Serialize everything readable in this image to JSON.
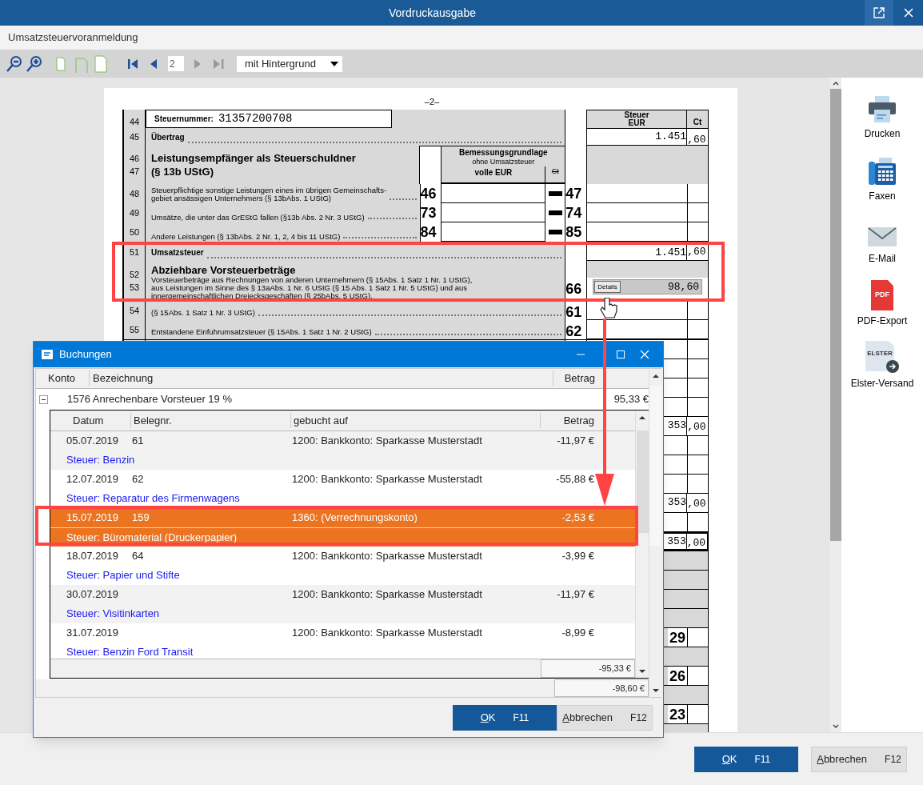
{
  "window": {
    "title": "Vordruckausgabe"
  },
  "header": {
    "title": "Umsatzsteuervoranmeldung"
  },
  "toolbar": {
    "page": "2",
    "background_mode": "mit Hintergrund",
    "nav": [
      {
        "kind": "first",
        "disabled": false
      },
      {
        "kind": "prev",
        "disabled": false
      },
      {
        "kind": "next",
        "disabled": true
      },
      {
        "kind": "last",
        "disabled": true
      }
    ]
  },
  "form": {
    "page_label": "–2–",
    "tax_id_line": "44",
    "tax_id_label": "Steuernummer:",
    "tax_id": "31357200708",
    "tax_header": {
      "line1": "Steuer",
      "line2": "EUR",
      "ct": "Ct"
    },
    "carry": {
      "line": "45",
      "label": "Übertrag",
      "eur": "1.451",
      "ct": ",60"
    },
    "section_13b": {
      "lines": [
        "46",
        "47"
      ],
      "heading": "Leistungsempfänger als Steuerschuldner",
      "subheading": "(§ 13b UStG)"
    },
    "base_header": {
      "line1": "Bemessungsgrundlage",
      "line2": "ohne Umsatzsteuer",
      "line3": "volle EUR",
      "ct": "Ct"
    },
    "rows_13b": [
      {
        "line": "48",
        "text": [
          "Steuerpflichtige sonstige Leistungen eines im übrigen Gemeinschafts-",
          "gebiet ansässigen Unternehmers (§ 13bAbs. 1 UStG)"
        ],
        "code_base": "46",
        "code_tax": "47"
      },
      {
        "line": "49",
        "text": [
          "Umsätze, die unter das GrEStG fallen (§13b Abs. 2 Nr. 3 UStG)"
        ],
        "code_base": "73",
        "code_tax": "74"
      },
      {
        "line": "50",
        "text": [
          "Andere Leistungen (§ 13bAbs. 2 Nr. 1, 2, 4 bis 11 UStG)"
        ],
        "code_base": "84",
        "code_tax": "85"
      }
    ],
    "vat": {
      "line": "51",
      "label": "Umsatzsteuer",
      "eur": "1.451",
      "ct": ",60"
    },
    "input_tax": {
      "lines": [
        "52",
        "53"
      ],
      "heading": "Abziehbare Vorsteuerbeträge",
      "text": [
        "Vorsteuerbeträge aus Rechnungen von anderen Unternehmern (§ 15Abs. 1 Satz 1 Nr. 1 UStG),",
        "aus Leistungen im Sinne des § 13aAbs. 1 Nr. 6 UStG (§ 15 Abs. 1 Satz 1 Nr. 5 UStG) und aus",
        "innergemeinschaftlichen Dreiecksgeschäften (§ 25bAbs. 5 UStG)."
      ],
      "code": "66",
      "details_button": "Details",
      "value": "98,60"
    },
    "rows_after": [
      {
        "line": "54",
        "text": "(§ 15Abs. 1 Satz 1  Nr. 3 UStG)",
        "code": "61"
      },
      {
        "line": "55",
        "text": "Entstandene Einfuhrumsatzsteuer (§ 15Abs. 1 Satz 1 Nr. 2 UStG)",
        "code": "62"
      }
    ],
    "lower_rows": [
      {
        "kind": "blank"
      },
      {
        "kind": "blank"
      },
      {
        "kind": "blank"
      },
      {
        "kind": "blank"
      },
      {
        "kind": "amount",
        "eur": "353",
        "ct": ",00"
      },
      {
        "kind": "blank"
      },
      {
        "kind": "blank"
      },
      {
        "kind": "blank"
      },
      {
        "kind": "amount",
        "eur": "353",
        "ct": ",00"
      },
      {
        "kind": "blank"
      },
      {
        "kind": "total",
        "eur": "353",
        "ct": ",00"
      },
      {
        "kind": "grey"
      },
      {
        "kind": "grey"
      },
      {
        "kind": "grey"
      },
      {
        "kind": "grey"
      },
      {
        "kind": "code",
        "code": "29"
      },
      {
        "kind": "grey"
      },
      {
        "kind": "code",
        "code": "26"
      },
      {
        "kind": "grey"
      },
      {
        "kind": "code",
        "code": "23"
      },
      {
        "kind": "grey"
      }
    ]
  },
  "dialog": {
    "title": "Buchungen",
    "columns": [
      "Konto",
      "Bezeichnung",
      "Betrag"
    ],
    "group": {
      "expanded": true,
      "label": "1576 Anrechenbare Vorsteuer 19 %",
      "amount": "95,33 €"
    },
    "inner_columns": [
      "Datum",
      "Belegnr.",
      "gebucht auf",
      "Betrag"
    ],
    "bookings": [
      {
        "date": "05.07.2019",
        "receipt": "61",
        "account": "1200: Bankkonto: Sparkasse Musterstadt",
        "amount": "-11,97 €",
        "note": "Steuer: Benzin",
        "selected": false
      },
      {
        "date": "12.07.2019",
        "receipt": "62",
        "account": "1200: Bankkonto: Sparkasse Musterstadt",
        "amount": "-55,88 €",
        "note": "Steuer: Reparatur des Firmenwagens",
        "selected": false
      },
      {
        "date": "15.07.2019",
        "receipt": "159",
        "account": "1360: (Verrechnungskonto)",
        "amount": "-2,53 €",
        "note": "Steuer: Büromaterial (Druckerpapier)",
        "selected": true
      },
      {
        "date": "18.07.2019",
        "receipt": "64",
        "account": "1200: Bankkonto: Sparkasse Musterstadt",
        "amount": "-3,99 €",
        "note": "Steuer: Papier und Stifte",
        "selected": false
      },
      {
        "date": "30.07.2019",
        "account": "1200: Bankkonto: Sparkasse Musterstadt",
        "amount": "-11,97 €",
        "note": "Steuer: Visitinkarten",
        "selected": false
      },
      {
        "date": "31.07.2019",
        "account": "1200: Bankkonto: Sparkasse Musterstadt",
        "amount": "-8,99 €",
        "note": "Steuer: Benzin Ford Transit",
        "selected": false
      }
    ],
    "inner_total": "-95,33 €",
    "total": "-98,60 €",
    "buttons": [
      {
        "label": "OK",
        "key": "F11",
        "kind": "primary"
      },
      {
        "label": "Abbrechen",
        "key": "F12",
        "kind": "secondary"
      }
    ]
  },
  "actions": [
    {
      "label": "Drucken",
      "kind": "print"
    },
    {
      "label": "Faxen",
      "kind": "fax"
    },
    {
      "label": "E-Mail",
      "kind": "mail"
    },
    {
      "label": "PDF-Export",
      "kind": "pdf",
      "icon_text": "PDF"
    },
    {
      "label": "Elster-Versand",
      "kind": "elster",
      "icon_text": "ELSTER"
    }
  ],
  "footer": {
    "buttons": [
      {
        "label": "OK",
        "key": "F11",
        "kind": "primary"
      },
      {
        "label": "Abbrechen",
        "key": "F12",
        "kind": "secondary"
      }
    ]
  }
}
